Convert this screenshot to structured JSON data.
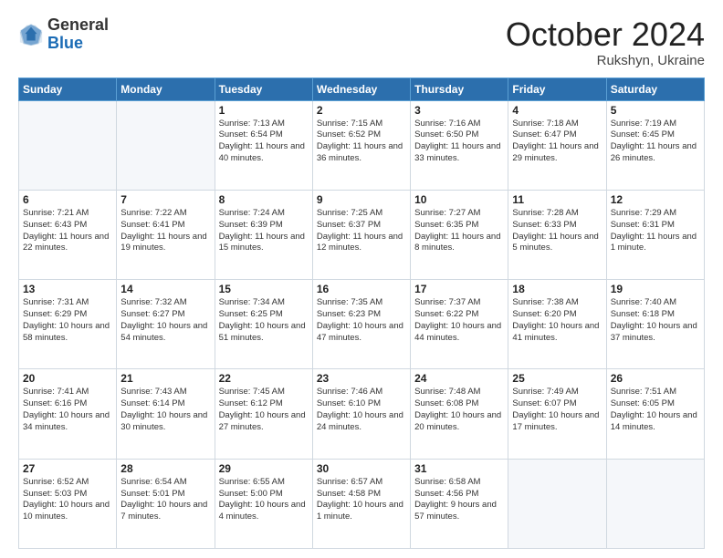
{
  "header": {
    "logo_general": "General",
    "logo_blue": "Blue",
    "month_title": "October 2024",
    "subtitle": "Rukshyn, Ukraine"
  },
  "weekdays": [
    "Sunday",
    "Monday",
    "Tuesday",
    "Wednesday",
    "Thursday",
    "Friday",
    "Saturday"
  ],
  "weeks": [
    [
      {
        "day": "",
        "empty": true
      },
      {
        "day": "",
        "empty": true
      },
      {
        "day": "1",
        "sunrise": "Sunrise: 7:13 AM",
        "sunset": "Sunset: 6:54 PM",
        "daylight": "Daylight: 11 hours and 40 minutes."
      },
      {
        "day": "2",
        "sunrise": "Sunrise: 7:15 AM",
        "sunset": "Sunset: 6:52 PM",
        "daylight": "Daylight: 11 hours and 36 minutes."
      },
      {
        "day": "3",
        "sunrise": "Sunrise: 7:16 AM",
        "sunset": "Sunset: 6:50 PM",
        "daylight": "Daylight: 11 hours and 33 minutes."
      },
      {
        "day": "4",
        "sunrise": "Sunrise: 7:18 AM",
        "sunset": "Sunset: 6:47 PM",
        "daylight": "Daylight: 11 hours and 29 minutes."
      },
      {
        "day": "5",
        "sunrise": "Sunrise: 7:19 AM",
        "sunset": "Sunset: 6:45 PM",
        "daylight": "Daylight: 11 hours and 26 minutes."
      }
    ],
    [
      {
        "day": "6",
        "sunrise": "Sunrise: 7:21 AM",
        "sunset": "Sunset: 6:43 PM",
        "daylight": "Daylight: 11 hours and 22 minutes."
      },
      {
        "day": "7",
        "sunrise": "Sunrise: 7:22 AM",
        "sunset": "Sunset: 6:41 PM",
        "daylight": "Daylight: 11 hours and 19 minutes."
      },
      {
        "day": "8",
        "sunrise": "Sunrise: 7:24 AM",
        "sunset": "Sunset: 6:39 PM",
        "daylight": "Daylight: 11 hours and 15 minutes."
      },
      {
        "day": "9",
        "sunrise": "Sunrise: 7:25 AM",
        "sunset": "Sunset: 6:37 PM",
        "daylight": "Daylight: 11 hours and 12 minutes."
      },
      {
        "day": "10",
        "sunrise": "Sunrise: 7:27 AM",
        "sunset": "Sunset: 6:35 PM",
        "daylight": "Daylight: 11 hours and 8 minutes."
      },
      {
        "day": "11",
        "sunrise": "Sunrise: 7:28 AM",
        "sunset": "Sunset: 6:33 PM",
        "daylight": "Daylight: 11 hours and 5 minutes."
      },
      {
        "day": "12",
        "sunrise": "Sunrise: 7:29 AM",
        "sunset": "Sunset: 6:31 PM",
        "daylight": "Daylight: 11 hours and 1 minute."
      }
    ],
    [
      {
        "day": "13",
        "sunrise": "Sunrise: 7:31 AM",
        "sunset": "Sunset: 6:29 PM",
        "daylight": "Daylight: 10 hours and 58 minutes."
      },
      {
        "day": "14",
        "sunrise": "Sunrise: 7:32 AM",
        "sunset": "Sunset: 6:27 PM",
        "daylight": "Daylight: 10 hours and 54 minutes."
      },
      {
        "day": "15",
        "sunrise": "Sunrise: 7:34 AM",
        "sunset": "Sunset: 6:25 PM",
        "daylight": "Daylight: 10 hours and 51 minutes."
      },
      {
        "day": "16",
        "sunrise": "Sunrise: 7:35 AM",
        "sunset": "Sunset: 6:23 PM",
        "daylight": "Daylight: 10 hours and 47 minutes."
      },
      {
        "day": "17",
        "sunrise": "Sunrise: 7:37 AM",
        "sunset": "Sunset: 6:22 PM",
        "daylight": "Daylight: 10 hours and 44 minutes."
      },
      {
        "day": "18",
        "sunrise": "Sunrise: 7:38 AM",
        "sunset": "Sunset: 6:20 PM",
        "daylight": "Daylight: 10 hours and 41 minutes."
      },
      {
        "day": "19",
        "sunrise": "Sunrise: 7:40 AM",
        "sunset": "Sunset: 6:18 PM",
        "daylight": "Daylight: 10 hours and 37 minutes."
      }
    ],
    [
      {
        "day": "20",
        "sunrise": "Sunrise: 7:41 AM",
        "sunset": "Sunset: 6:16 PM",
        "daylight": "Daylight: 10 hours and 34 minutes."
      },
      {
        "day": "21",
        "sunrise": "Sunrise: 7:43 AM",
        "sunset": "Sunset: 6:14 PM",
        "daylight": "Daylight: 10 hours and 30 minutes."
      },
      {
        "day": "22",
        "sunrise": "Sunrise: 7:45 AM",
        "sunset": "Sunset: 6:12 PM",
        "daylight": "Daylight: 10 hours and 27 minutes."
      },
      {
        "day": "23",
        "sunrise": "Sunrise: 7:46 AM",
        "sunset": "Sunset: 6:10 PM",
        "daylight": "Daylight: 10 hours and 24 minutes."
      },
      {
        "day": "24",
        "sunrise": "Sunrise: 7:48 AM",
        "sunset": "Sunset: 6:08 PM",
        "daylight": "Daylight: 10 hours and 20 minutes."
      },
      {
        "day": "25",
        "sunrise": "Sunrise: 7:49 AM",
        "sunset": "Sunset: 6:07 PM",
        "daylight": "Daylight: 10 hours and 17 minutes."
      },
      {
        "day": "26",
        "sunrise": "Sunrise: 7:51 AM",
        "sunset": "Sunset: 6:05 PM",
        "daylight": "Daylight: 10 hours and 14 minutes."
      }
    ],
    [
      {
        "day": "27",
        "sunrise": "Sunrise: 6:52 AM",
        "sunset": "Sunset: 5:03 PM",
        "daylight": "Daylight: 10 hours and 10 minutes."
      },
      {
        "day": "28",
        "sunrise": "Sunrise: 6:54 AM",
        "sunset": "Sunset: 5:01 PM",
        "daylight": "Daylight: 10 hours and 7 minutes."
      },
      {
        "day": "29",
        "sunrise": "Sunrise: 6:55 AM",
        "sunset": "Sunset: 5:00 PM",
        "daylight": "Daylight: 10 hours and 4 minutes."
      },
      {
        "day": "30",
        "sunrise": "Sunrise: 6:57 AM",
        "sunset": "Sunset: 4:58 PM",
        "daylight": "Daylight: 10 hours and 1 minute."
      },
      {
        "day": "31",
        "sunrise": "Sunrise: 6:58 AM",
        "sunset": "Sunset: 4:56 PM",
        "daylight": "Daylight: 9 hours and 57 minutes."
      },
      {
        "day": "",
        "empty": true
      },
      {
        "day": "",
        "empty": true
      }
    ]
  ]
}
